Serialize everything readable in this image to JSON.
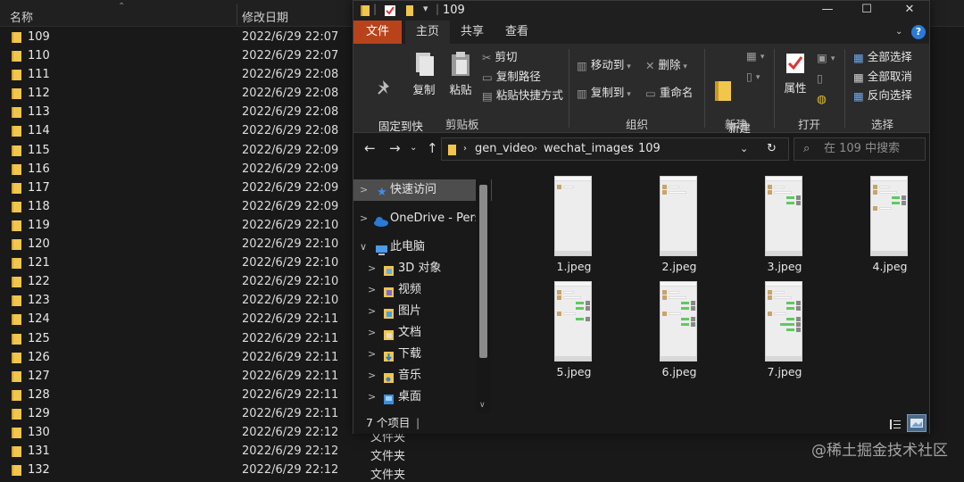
{
  "background_list": {
    "columns": {
      "name": "名称",
      "modified": "修改日期"
    },
    "rows": [
      {
        "name": "109",
        "date": "2022/6/29 22:07"
      },
      {
        "name": "110",
        "date": "2022/6/29 22:07"
      },
      {
        "name": "111",
        "date": "2022/6/29 22:08"
      },
      {
        "name": "112",
        "date": "2022/6/29 22:08"
      },
      {
        "name": "113",
        "date": "2022/6/29 22:08"
      },
      {
        "name": "114",
        "date": "2022/6/29 22:08"
      },
      {
        "name": "115",
        "date": "2022/6/29 22:09"
      },
      {
        "name": "116",
        "date": "2022/6/29 22:09"
      },
      {
        "name": "117",
        "date": "2022/6/29 22:09"
      },
      {
        "name": "118",
        "date": "2022/6/29 22:09"
      },
      {
        "name": "119",
        "date": "2022/6/29 22:10"
      },
      {
        "name": "120",
        "date": "2022/6/29 22:10"
      },
      {
        "name": "121",
        "date": "2022/6/29 22:10"
      },
      {
        "name": "122",
        "date": "2022/6/29 22:10"
      },
      {
        "name": "123",
        "date": "2022/6/29 22:10"
      },
      {
        "name": "124",
        "date": "2022/6/29 22:11"
      },
      {
        "name": "125",
        "date": "2022/6/29 22:11"
      },
      {
        "name": "126",
        "date": "2022/6/29 22:11"
      },
      {
        "name": "127",
        "date": "2022/6/29 22:11"
      },
      {
        "name": "128",
        "date": "2022/6/29 22:11"
      },
      {
        "name": "129",
        "date": "2022/6/29 22:11"
      },
      {
        "name": "130",
        "date": "2022/6/29 22:12"
      },
      {
        "name": "131",
        "date": "2022/6/29 22:12"
      },
      {
        "name": "132",
        "date": "2022/6/29 22:12"
      }
    ],
    "type_values": [
      "文件夹",
      "文件夹",
      "文件夹"
    ]
  },
  "window": {
    "title": "109",
    "controls": {
      "minimize": "—",
      "maximize": "☐",
      "close": "✕"
    }
  },
  "tabs": {
    "file": "文件",
    "home": "主页",
    "share": "共享",
    "view": "查看",
    "help": "?"
  },
  "ribbon": {
    "pin": "固定到快\n速访问",
    "copy": "复制",
    "paste": "粘贴",
    "cut": "剪切",
    "copy_path": "复制路径",
    "paste_shortcut": "粘贴快捷方式",
    "clipboard_group": "剪贴板",
    "move_to": "移动到",
    "copy_to": "复制到",
    "delete": "删除",
    "rename": "重命名",
    "organize_group": "组织",
    "new_folder": "新建\n文件夹",
    "new_group": "新建",
    "properties": "属性",
    "open_group": "打开",
    "select_all": "全部选择",
    "select_none": "全部取消",
    "invert_selection": "反向选择",
    "select_group": "选择"
  },
  "address": {
    "segments": [
      "gen_video",
      "wechat_images",
      "109"
    ],
    "search_placeholder": "在 109 中搜索"
  },
  "nav_pane": {
    "quick_access": "快速访问",
    "onedrive": "OneDrive - Perso",
    "this_pc": "此电脑",
    "items": [
      "3D 对象",
      "视频",
      "图片",
      "文档",
      "下载",
      "音乐",
      "桌面"
    ]
  },
  "files": [
    "1.jpeg",
    "2.jpeg",
    "3.jpeg",
    "4.jpeg",
    "5.jpeg",
    "6.jpeg",
    "7.jpeg"
  ],
  "status": {
    "count": "7 个项目"
  },
  "watermark": "@稀土掘金技术社区",
  "colors": {
    "file_tab": "#b8431b",
    "folder": "#f0c64c",
    "accent": "#2a7ad6",
    "wechat_bubble": "#5fc95f"
  }
}
